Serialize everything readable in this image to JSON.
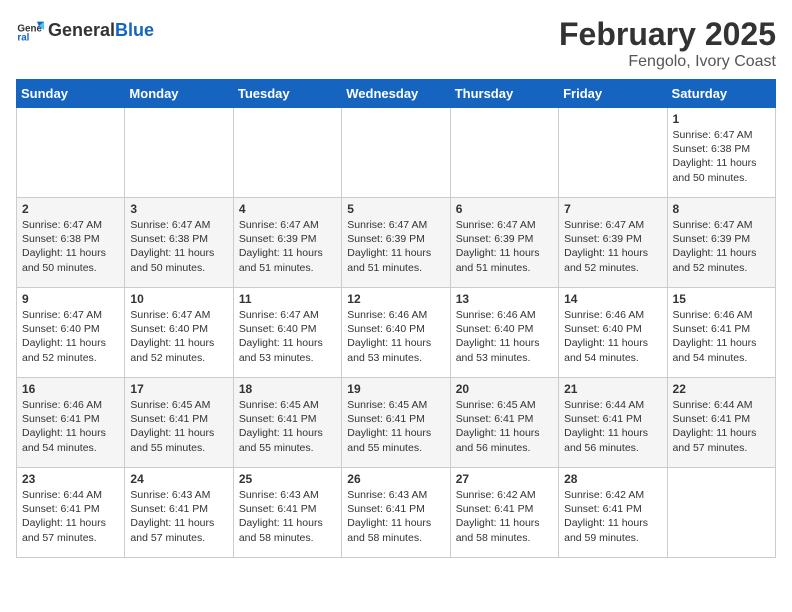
{
  "logo": {
    "general": "General",
    "blue": "Blue"
  },
  "title": "February 2025",
  "location": "Fengolo, Ivory Coast",
  "days_of_week": [
    "Sunday",
    "Monday",
    "Tuesday",
    "Wednesday",
    "Thursday",
    "Friday",
    "Saturday"
  ],
  "weeks": [
    [
      {
        "day": "",
        "content": ""
      },
      {
        "day": "",
        "content": ""
      },
      {
        "day": "",
        "content": ""
      },
      {
        "day": "",
        "content": ""
      },
      {
        "day": "",
        "content": ""
      },
      {
        "day": "",
        "content": ""
      },
      {
        "day": "1",
        "content": "Sunrise: 6:47 AM\nSunset: 6:38 PM\nDaylight: 11 hours and 50 minutes."
      }
    ],
    [
      {
        "day": "2",
        "content": "Sunrise: 6:47 AM\nSunset: 6:38 PM\nDaylight: 11 hours and 50 minutes."
      },
      {
        "day": "3",
        "content": "Sunrise: 6:47 AM\nSunset: 6:38 PM\nDaylight: 11 hours and 50 minutes."
      },
      {
        "day": "4",
        "content": "Sunrise: 6:47 AM\nSunset: 6:39 PM\nDaylight: 11 hours and 51 minutes."
      },
      {
        "day": "5",
        "content": "Sunrise: 6:47 AM\nSunset: 6:39 PM\nDaylight: 11 hours and 51 minutes."
      },
      {
        "day": "6",
        "content": "Sunrise: 6:47 AM\nSunset: 6:39 PM\nDaylight: 11 hours and 51 minutes."
      },
      {
        "day": "7",
        "content": "Sunrise: 6:47 AM\nSunset: 6:39 PM\nDaylight: 11 hours and 52 minutes."
      },
      {
        "day": "8",
        "content": "Sunrise: 6:47 AM\nSunset: 6:39 PM\nDaylight: 11 hours and 52 minutes."
      }
    ],
    [
      {
        "day": "9",
        "content": "Sunrise: 6:47 AM\nSunset: 6:40 PM\nDaylight: 11 hours and 52 minutes."
      },
      {
        "day": "10",
        "content": "Sunrise: 6:47 AM\nSunset: 6:40 PM\nDaylight: 11 hours and 52 minutes."
      },
      {
        "day": "11",
        "content": "Sunrise: 6:47 AM\nSunset: 6:40 PM\nDaylight: 11 hours and 53 minutes."
      },
      {
        "day": "12",
        "content": "Sunrise: 6:46 AM\nSunset: 6:40 PM\nDaylight: 11 hours and 53 minutes."
      },
      {
        "day": "13",
        "content": "Sunrise: 6:46 AM\nSunset: 6:40 PM\nDaylight: 11 hours and 53 minutes."
      },
      {
        "day": "14",
        "content": "Sunrise: 6:46 AM\nSunset: 6:40 PM\nDaylight: 11 hours and 54 minutes."
      },
      {
        "day": "15",
        "content": "Sunrise: 6:46 AM\nSunset: 6:41 PM\nDaylight: 11 hours and 54 minutes."
      }
    ],
    [
      {
        "day": "16",
        "content": "Sunrise: 6:46 AM\nSunset: 6:41 PM\nDaylight: 11 hours and 54 minutes."
      },
      {
        "day": "17",
        "content": "Sunrise: 6:45 AM\nSunset: 6:41 PM\nDaylight: 11 hours and 55 minutes."
      },
      {
        "day": "18",
        "content": "Sunrise: 6:45 AM\nSunset: 6:41 PM\nDaylight: 11 hours and 55 minutes."
      },
      {
        "day": "19",
        "content": "Sunrise: 6:45 AM\nSunset: 6:41 PM\nDaylight: 11 hours and 55 minutes."
      },
      {
        "day": "20",
        "content": "Sunrise: 6:45 AM\nSunset: 6:41 PM\nDaylight: 11 hours and 56 minutes."
      },
      {
        "day": "21",
        "content": "Sunrise: 6:44 AM\nSunset: 6:41 PM\nDaylight: 11 hours and 56 minutes."
      },
      {
        "day": "22",
        "content": "Sunrise: 6:44 AM\nSunset: 6:41 PM\nDaylight: 11 hours and 57 minutes."
      }
    ],
    [
      {
        "day": "23",
        "content": "Sunrise: 6:44 AM\nSunset: 6:41 PM\nDaylight: 11 hours and 57 minutes."
      },
      {
        "day": "24",
        "content": "Sunrise: 6:43 AM\nSunset: 6:41 PM\nDaylight: 11 hours and 57 minutes."
      },
      {
        "day": "25",
        "content": "Sunrise: 6:43 AM\nSunset: 6:41 PM\nDaylight: 11 hours and 58 minutes."
      },
      {
        "day": "26",
        "content": "Sunrise: 6:43 AM\nSunset: 6:41 PM\nDaylight: 11 hours and 58 minutes."
      },
      {
        "day": "27",
        "content": "Sunrise: 6:42 AM\nSunset: 6:41 PM\nDaylight: 11 hours and 58 minutes."
      },
      {
        "day": "28",
        "content": "Sunrise: 6:42 AM\nSunset: 6:41 PM\nDaylight: 11 hours and 59 minutes."
      },
      {
        "day": "",
        "content": ""
      }
    ]
  ]
}
